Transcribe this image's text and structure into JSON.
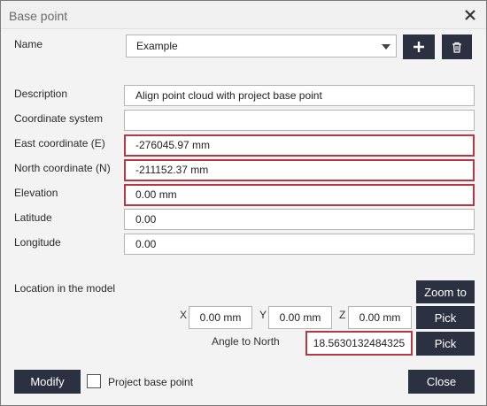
{
  "window": {
    "title": "Base point"
  },
  "name": {
    "label": "Name",
    "selected": "Example",
    "add_label": "+",
    "delete_icon": "trash-icon"
  },
  "fields": {
    "description": {
      "label": "Description",
      "value": "Align point cloud with project base point"
    },
    "coordinate_system": {
      "label": "Coordinate system",
      "value": ""
    },
    "east": {
      "label": "East coordinate  (E)",
      "value": "-276045.97 mm"
    },
    "north": {
      "label": "North coordinate  (N)",
      "value": "-211152.37 mm"
    },
    "elevation": {
      "label": "Elevation",
      "value": "0.00 mm"
    },
    "latitude": {
      "label": "Latitude",
      "value": "0.00"
    },
    "longitude": {
      "label": "Longitude",
      "value": "0.00"
    }
  },
  "location": {
    "label": "Location in the model",
    "x_label": "X",
    "x_value": "0.00 mm",
    "y_label": "Y",
    "y_value": "0.00 mm",
    "z_label": "Z",
    "z_value": "0.00 mm",
    "zoom_label": "Zoom to",
    "pick_label": "Pick",
    "angle_label": "Angle to North",
    "angle_value": "18.5630132484325",
    "pick_angle_label": "Pick"
  },
  "footer": {
    "modify_label": "Modify",
    "project_base_point_label": "Project base point",
    "project_base_point_checked": false,
    "close_label": "Close"
  },
  "colors": {
    "button_bg": "#2c3142",
    "highlight_border": "#b33a45"
  }
}
